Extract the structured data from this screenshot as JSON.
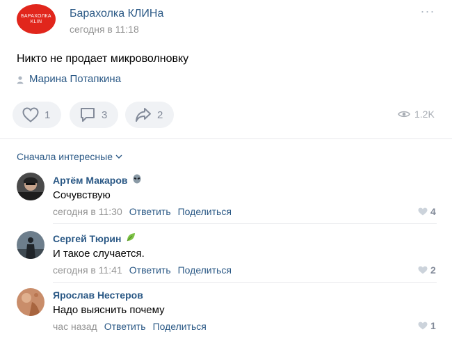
{
  "post": {
    "group_name": "Барахолка КЛИНа",
    "time": "сегодня в 11:18",
    "avatar_text_line1": "БАРАХОЛКА",
    "avatar_text_line2": "KLIN",
    "avatar_color": "#e1261c",
    "text": "Никто не продает микроволновку",
    "author": "Марина Потапкина",
    "more_icon": "more-dots-icon"
  },
  "actions": {
    "likes": "1",
    "comments": "3",
    "shares": "2",
    "views": "1.2K"
  },
  "comments_sort_label": "Сначала интересные",
  "comments": [
    {
      "name": "Артём Макаров",
      "badge_icon": "alien-icon",
      "text": "Сочувствую",
      "time": "сегодня в 11:30",
      "reply_label": "Ответить",
      "share_label": "Поделиться",
      "likes": "4"
    },
    {
      "name": "Сергей Тюрин",
      "badge_icon": "leaf-icon",
      "text": "И такое случается.",
      "time": "сегодня в 11:41",
      "reply_label": "Ответить",
      "share_label": "Поделиться",
      "likes": "2"
    },
    {
      "name": "Ярослав Нестеров",
      "badge_icon": "",
      "text": "Надо выяснить почему",
      "time": "час назад",
      "reply_label": "Ответить",
      "share_label": "Поделиться",
      "likes": "1"
    }
  ],
  "colors": {
    "link": "#2a5885",
    "muted": "#939393",
    "pill_bg": "#f0f2f5",
    "icon": "#828a99"
  }
}
